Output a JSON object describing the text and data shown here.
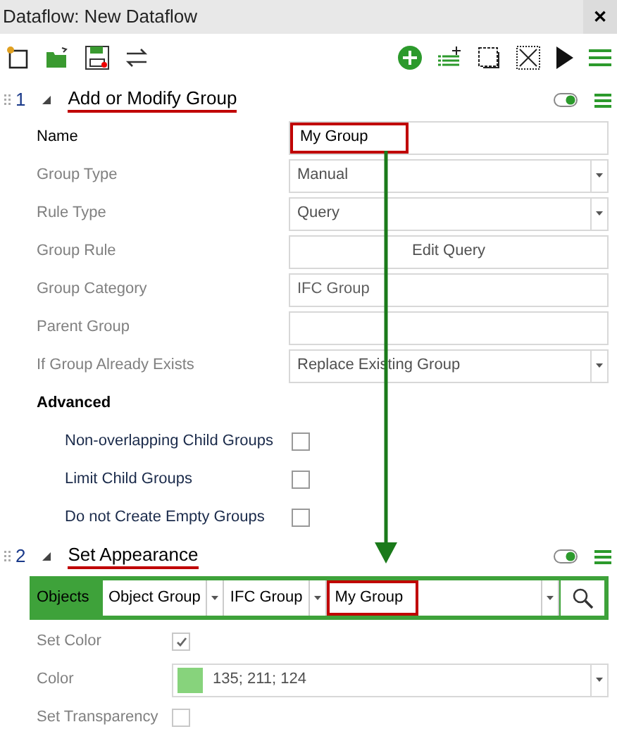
{
  "window": {
    "title": "Dataflow: New Dataflow",
    "close": "✕"
  },
  "steps": [
    {
      "number": "1",
      "title": "Add or Modify Group",
      "expanded": true,
      "enabled": true,
      "highlighted": true,
      "fields": [
        {
          "kind": "text",
          "label": "Name",
          "value": "My Group",
          "disabled": false,
          "highlighted": true
        },
        {
          "kind": "dropdown",
          "label": "Group Type",
          "value": "Manual",
          "disabled": true,
          "highlighted": false
        },
        {
          "kind": "dropdown",
          "label": "Rule Type",
          "value": "Query",
          "disabled": true,
          "highlighted": false
        },
        {
          "kind": "button",
          "label": "Group Rule",
          "value": "Edit Query",
          "disabled": true,
          "highlighted": false
        },
        {
          "kind": "text",
          "label": "Group Category",
          "value": "IFC Group",
          "disabled": true,
          "highlighted": false
        },
        {
          "kind": "text",
          "label": "Parent Group",
          "disabled": true,
          "highlighted": false
        },
        {
          "kind": "dropdown",
          "label": "If Group Already Exists",
          "value": "Replace Existing Group",
          "disabled": true,
          "highlighted": false
        }
      ],
      "advanced": {
        "title": "Advanced",
        "options": [
          {
            "label": "Non-overlapping Child Groups",
            "checked": false
          },
          {
            "label": "Limit Child Groups",
            "checked": false
          },
          {
            "label": "Do not Create Empty Groups",
            "checked": false
          }
        ]
      }
    },
    {
      "number": "2",
      "title": "Set Appearance",
      "expanded": true,
      "enabled": true,
      "highlighted": true,
      "objects": {
        "label": "Objects",
        "selectors": [
          {
            "value": "Object Group",
            "highlighted": false
          },
          {
            "value": "IFC Group",
            "highlighted": false
          },
          {
            "value": "My Group",
            "highlighted": true
          }
        ]
      },
      "fields": [
        {
          "kind": "checkbox",
          "label": "Set Color",
          "checked": true,
          "disabled": true
        },
        {
          "kind": "color",
          "label": "Color",
          "value": "135; 211; 124",
          "disabled": true
        },
        {
          "kind": "checkbox",
          "label": "Set Transparency",
          "checked": false,
          "disabled": true
        }
      ]
    }
  ]
}
